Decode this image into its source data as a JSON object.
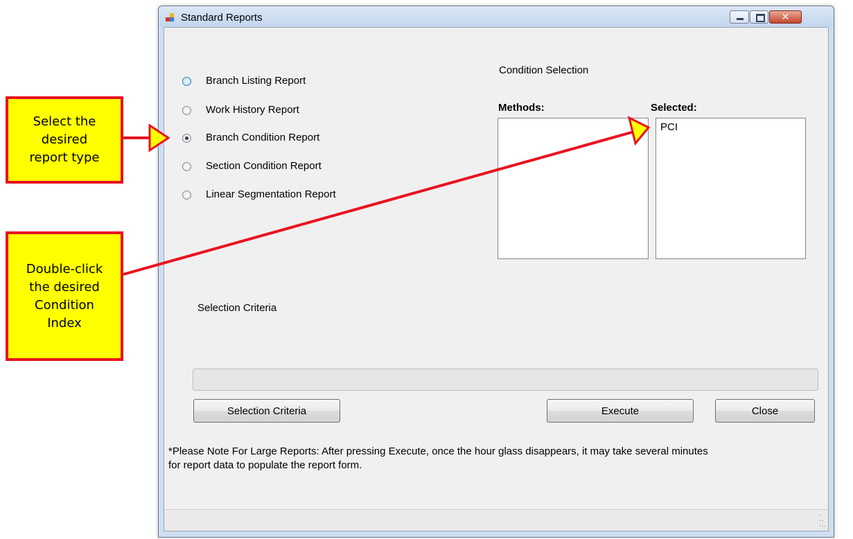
{
  "window": {
    "title": "Standard Reports",
    "controls": {
      "minimize": "minimize-icon",
      "maximize": "maximize-icon",
      "close": "✕"
    }
  },
  "report_types": [
    {
      "label": "Branch Listing Report",
      "selected": false
    },
    {
      "label": "Work History Report",
      "selected": false
    },
    {
      "label": "Branch Condition Report",
      "selected": true
    },
    {
      "label": "Section Condition Report",
      "selected": false
    },
    {
      "label": "Linear Segmentation Report",
      "selected": false
    }
  ],
  "condition_selection": {
    "title": "Condition Selection",
    "methods_label": "Methods:",
    "selected_label": "Selected:",
    "methods_items": [],
    "selected_items": [
      "PCI"
    ]
  },
  "selection_criteria": {
    "label": "Selection Criteria"
  },
  "buttons": {
    "selection_criteria": "Selection Criteria",
    "execute": "Execute",
    "close": "Close"
  },
  "note": {
    "line1": "*Please Note For Large Reports:  After pressing Execute, once the hour glass disappears, it may take several minutes",
    "line2": "for report data to populate the report form."
  },
  "callouts": {
    "report_type": [
      "Select the",
      "desired",
      "report type"
    ],
    "condition_index": [
      "Double-click",
      "the desired",
      "Condition",
      "Index"
    ]
  },
  "colors": {
    "callout_fill": "#ffff00",
    "callout_border": "#e8131f",
    "arrow_stroke": "#e8131f",
    "arrow_head": "#ffff00"
  }
}
